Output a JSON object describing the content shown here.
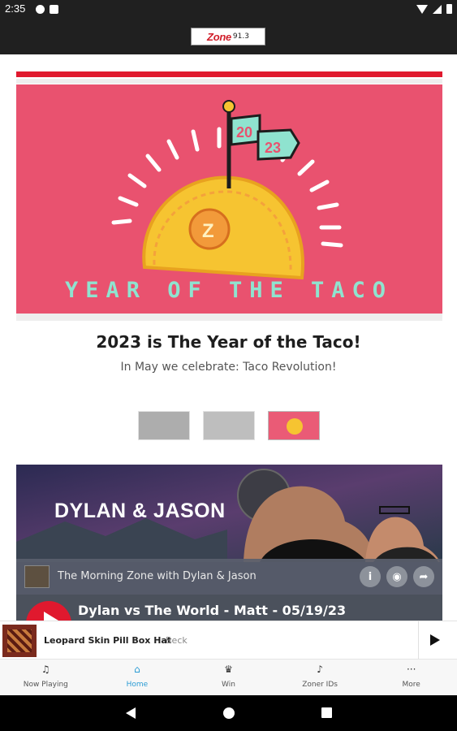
{
  "status_bar": {
    "time": "2:35"
  },
  "app": {
    "logo_text": "Zone",
    "logo_freq": "91.3"
  },
  "hero": {
    "art_year": "2023",
    "art_year_top": "20",
    "art_year_bottom": "23",
    "art_caption": "YEAR OF THE TACO",
    "title": "2023 is The Year of the Taco!",
    "subtitle": "In May we celebrate: Taco Revolution!",
    "active_slide": 3,
    "slide_count": 3
  },
  "podcast": {
    "art_title": "DYLAN & JASON",
    "show_name": "The Morning Zone with Dylan & Jason",
    "episode_title": "Dylan vs The World - Matt - 05/19/23",
    "info_icon": "info-icon",
    "podcast_icon": "podcast-icon",
    "share_icon": "share-icon"
  },
  "now_playing": {
    "song": "Leopard Skin Pill Box Hat",
    "artist": "Beck"
  },
  "nav": {
    "items": [
      {
        "label": "Now Playing",
        "icon": "music-note-icon"
      },
      {
        "label": "Home",
        "icon": "home-icon"
      },
      {
        "label": "Win",
        "icon": "trophy-icon"
      },
      {
        "label": "Zoner IDs",
        "icon": "microphone-icon"
      },
      {
        "label": "More",
        "icon": "more-icon"
      }
    ],
    "active": "Home"
  },
  "colors": {
    "accent": "#2a9bd4",
    "brand_red": "#e0192e",
    "taco_pink": "#e9526f",
    "taco_yellow": "#f6c431",
    "teal": "#8fe3cf"
  }
}
